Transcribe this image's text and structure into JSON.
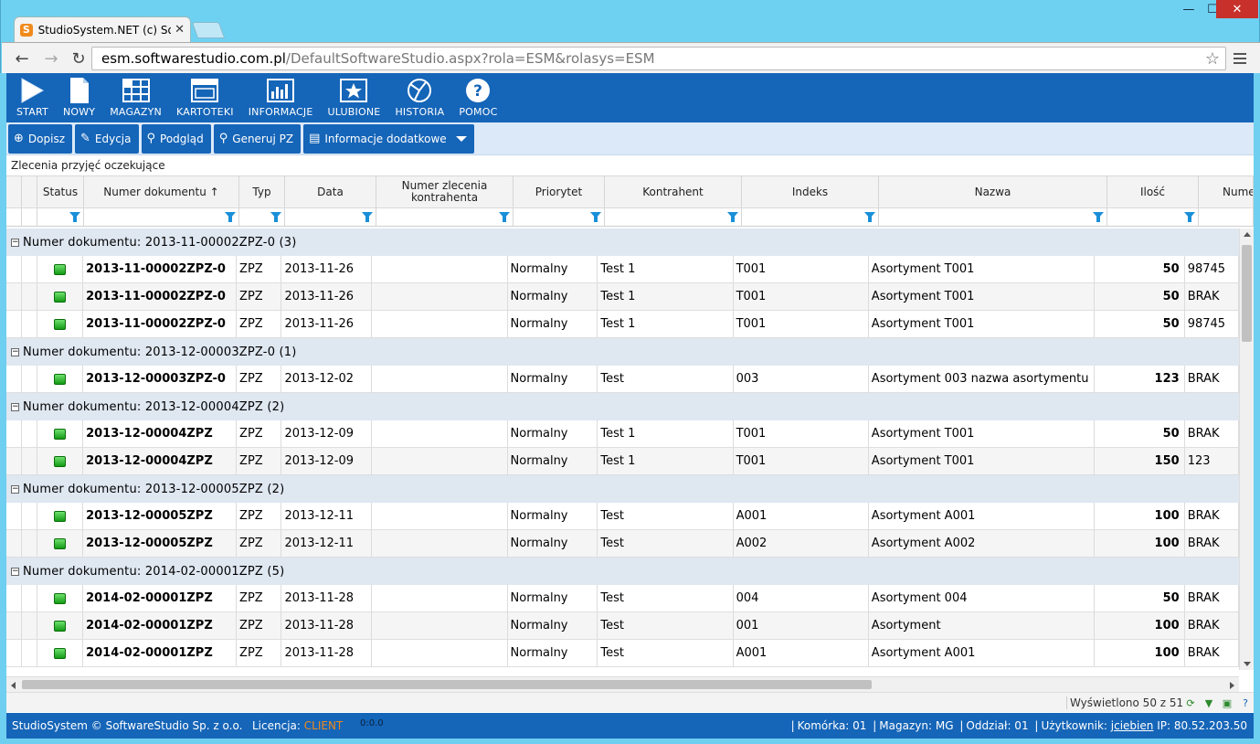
{
  "browser": {
    "tab_title": "StudioSystem.NET (c) Soft",
    "url_host": "esm.softwarestudio.com.pl",
    "url_path": "/DefaultSoftwareStudio.aspx?rola=ESM&rolasys=ESM"
  },
  "nav": [
    {
      "label": "START",
      "icon": "play-icon"
    },
    {
      "label": "NOWY",
      "icon": "document-icon"
    },
    {
      "label": "MAGAZYN",
      "icon": "warehouse-icon"
    },
    {
      "label": "KARTOTEKI",
      "icon": "window-icon"
    },
    {
      "label": "INFORMACJE",
      "icon": "chart-icon"
    },
    {
      "label": "ULUBIONE",
      "icon": "star-icon"
    },
    {
      "label": "HISTORIA",
      "icon": "history-icon"
    },
    {
      "label": "POMOC",
      "icon": "help-icon"
    }
  ],
  "actions": {
    "add": "Dopisz",
    "edit": "Edycja",
    "preview": "Podgląd",
    "generate": "Generuj PZ",
    "more": "Informacje dodatkowe"
  },
  "subtitle": "Zlecenia przyjęć oczekujące",
  "columns": {
    "status": "Status",
    "numer": "Numer dokumentu ↑",
    "typ": "Typ",
    "data": "Data",
    "numer_kontr": "Numer zlecenia kontrahenta",
    "priorytet": "Priorytet",
    "kontrahent": "Kontrahent",
    "indeks": "Indeks",
    "nazwa": "Nazwa",
    "ilosc": "Ilość",
    "nume": "Nume"
  },
  "groups": [
    {
      "label": "Numer dokumentu: 2013-11-00002ZPZ-0 (3)",
      "rows": [
        {
          "numer": "2013-11-00002ZPZ-0",
          "typ": "ZPZ",
          "data": "2013-11-26",
          "priorytet": "Normalny",
          "kontrahent": "Test 1",
          "indeks": "T001",
          "nazwa": "Asortyment T001",
          "ilosc": "50",
          "nume": "98745"
        },
        {
          "numer": "2013-11-00002ZPZ-0",
          "typ": "ZPZ",
          "data": "2013-11-26",
          "priorytet": "Normalny",
          "kontrahent": "Test 1",
          "indeks": "T001",
          "nazwa": "Asortyment T001",
          "ilosc": "50",
          "nume": "BRAK"
        },
        {
          "numer": "2013-11-00002ZPZ-0",
          "typ": "ZPZ",
          "data": "2013-11-26",
          "priorytet": "Normalny",
          "kontrahent": "Test 1",
          "indeks": "T001",
          "nazwa": "Asortyment T001",
          "ilosc": "50",
          "nume": "98745"
        }
      ]
    },
    {
      "label": "Numer dokumentu: 2013-12-00003ZPZ-0 (1)",
      "rows": [
        {
          "numer": "2013-12-00003ZPZ-0",
          "typ": "ZPZ",
          "data": "2013-12-02",
          "priorytet": "Normalny",
          "kontrahent": "Test",
          "indeks": "003",
          "nazwa": "Asortyment 003 nazwa asortymentu …",
          "ilosc": "123",
          "nume": "BRAK"
        }
      ]
    },
    {
      "label": "Numer dokumentu: 2013-12-00004ZPZ (2)",
      "rows": [
        {
          "numer": "2013-12-00004ZPZ",
          "typ": "ZPZ",
          "data": "2013-12-09",
          "priorytet": "Normalny",
          "kontrahent": "Test 1",
          "indeks": "T001",
          "nazwa": "Asortyment T001",
          "ilosc": "50",
          "nume": "BRAK"
        },
        {
          "numer": "2013-12-00004ZPZ",
          "typ": "ZPZ",
          "data": "2013-12-09",
          "priorytet": "Normalny",
          "kontrahent": "Test 1",
          "indeks": "T001",
          "nazwa": "Asortyment T001",
          "ilosc": "150",
          "nume": "123"
        }
      ]
    },
    {
      "label": "Numer dokumentu: 2013-12-00005ZPZ (2)",
      "rows": [
        {
          "numer": "2013-12-00005ZPZ",
          "typ": "ZPZ",
          "data": "2013-12-11",
          "priorytet": "Normalny",
          "kontrahent": "Test",
          "indeks": "A001",
          "nazwa": "Asortyment A001",
          "ilosc": "100",
          "nume": "BRAK"
        },
        {
          "numer": "2013-12-00005ZPZ",
          "typ": "ZPZ",
          "data": "2013-12-11",
          "priorytet": "Normalny",
          "kontrahent": "Test",
          "indeks": "A002",
          "nazwa": "Asortyment A002",
          "ilosc": "100",
          "nume": "BRAK"
        }
      ]
    },
    {
      "label": "Numer dokumentu: 2014-02-00001ZPZ (5)",
      "rows": [
        {
          "numer": "2014-02-00001ZPZ",
          "typ": "ZPZ",
          "data": "2013-11-28",
          "priorytet": "Normalny",
          "kontrahent": "Test",
          "indeks": "004",
          "nazwa": "Asortyment 004",
          "ilosc": "50",
          "nume": "BRAK"
        },
        {
          "numer": "2014-02-00001ZPZ",
          "typ": "ZPZ",
          "data": "2013-11-28",
          "priorytet": "Normalny",
          "kontrahent": "Test",
          "indeks": "001",
          "nazwa": "Asortyment",
          "ilosc": "100",
          "nume": "BRAK"
        },
        {
          "numer": "2014-02-00001ZPZ",
          "typ": "ZPZ",
          "data": "2013-11-28",
          "priorytet": "Normalny",
          "kontrahent": "Test",
          "indeks": "A001",
          "nazwa": "Asortyment A001",
          "ilosc": "100",
          "nume": "BRAK"
        }
      ]
    }
  ],
  "pager": "Wyświetlono 50 z 51",
  "footer": {
    "copyright": "StudioSystem © SoftwareStudio Sp. z o.o.",
    "license_label": "Licencja:",
    "license_value": "CLIENT",
    "time": "0:0.0",
    "komorka": "Komórka: 01",
    "magazyn": "Magazyn: MG",
    "oddzial": "Oddział: 01",
    "uzytkownik_label": "Użytkownik:",
    "uzytkownik": "jciebien",
    "ip": "IP: 80.52.203.50"
  },
  "colors": {
    "brand": "#1565b8",
    "accent": "#f08a1c",
    "status_ok": "#149a14"
  }
}
